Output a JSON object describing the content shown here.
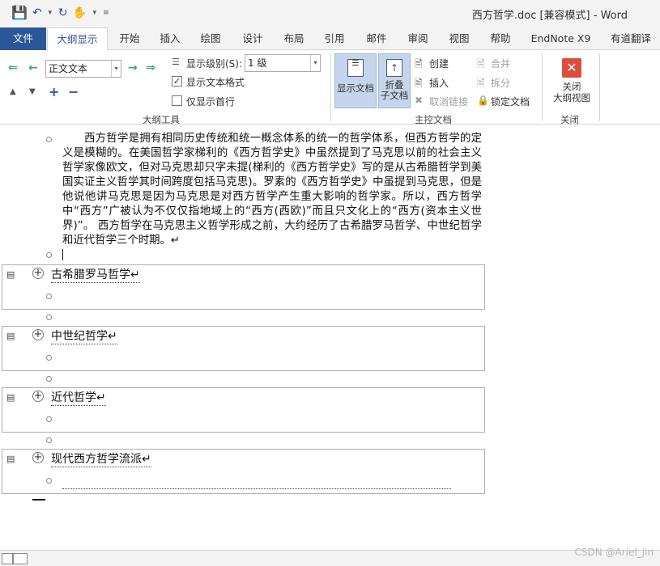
{
  "window": {
    "title": "西方哲学.doc [兼容模式] - Word"
  },
  "tabs": [
    "文件",
    "大纲显示",
    "开始",
    "插入",
    "绘图",
    "设计",
    "布局",
    "引用",
    "邮件",
    "审阅",
    "视图",
    "帮助",
    "EndNote X9",
    "有道翻译"
  ],
  "ribbon": {
    "outline_tools": {
      "style_combo": "正文文本",
      "show_level_label": "显示级别(S):",
      "show_level_value": "1 级",
      "show_text_format": "显示文本格式",
      "show_text_format_checked": true,
      "show_first_line_only": "仅显示首行",
      "show_first_line_only_checked": false,
      "group_label": "大纲工具"
    },
    "master_doc": {
      "show_doc": "显示文档",
      "collapse_sub": "折叠\n子文档",
      "create": "创建",
      "insert": "插入",
      "unlink": "取消链接",
      "merge": "合并",
      "split": "拆分",
      "lock": "锁定文档",
      "group_label": "主控文档"
    },
    "close": {
      "close_outline": "关闭\n大纲视图",
      "group_label": "关闭"
    }
  },
  "document": {
    "paragraph": "西方哲学是拥有相同历史传统和统一概念体系的统一的哲学体系，但西方哲学的定义是模糊的。在美国哲学家梯利的《西方哲学史》中虽然提到了马克思以前的社会主义哲学家像欧文，但对马克思却只字未提(梯利的《西方哲学史》写的是从古希腊哲学到美国实证主义哲学其时间跨度包括马克思)。罗素的《西方哲学史》中虽提到马克思，但是他说他讲马克思是因为马克思是对西方哲学产生重大影响的哲学家。所以，西方哲学中“西方”广被认为不仅仅指地域上的“西方(西欧)”而且只文化上的“西方(资本主义世界)”。      西方哲学在马克思主义哲学形成之前，大约经历了古希腊罗马哲学、中世纪哲学和近代哲学三个时期。↵",
    "headings": [
      "古希腊罗马哲学↵",
      "中世纪哲学↵",
      "近代哲学↵",
      "现代西方哲学流派↵"
    ]
  },
  "watermark": "CSDN @Ariel_jin"
}
